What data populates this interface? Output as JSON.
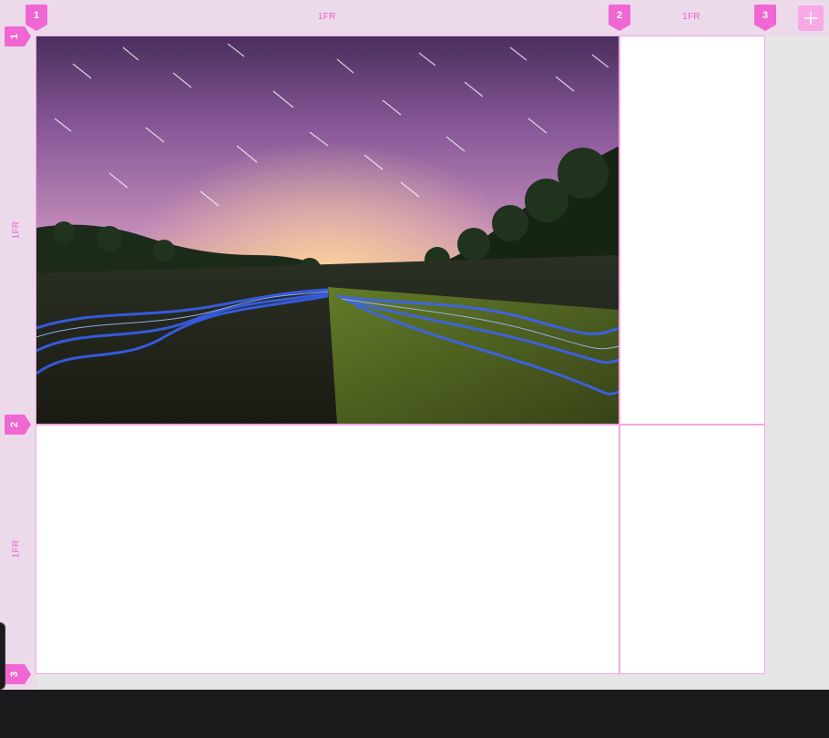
{
  "grid": {
    "columns": {
      "track_labels": [
        "1FR",
        "1FR"
      ],
      "line_markers": [
        "1",
        "2",
        "3"
      ]
    },
    "rows": {
      "track_labels": [
        "1FR",
        "1FR"
      ],
      "line_markers": [
        "1",
        "2",
        "3"
      ]
    }
  },
  "toolbar": {
    "add_icon": "plus-icon"
  },
  "colors": {
    "accent": "#f067d3",
    "grid_line": "#f2a6e3",
    "ruler_bg": "#ecdaea",
    "dark_bar": "#1b1b1d"
  },
  "image": {
    "subject": "starry-sky-field-light-painting"
  }
}
